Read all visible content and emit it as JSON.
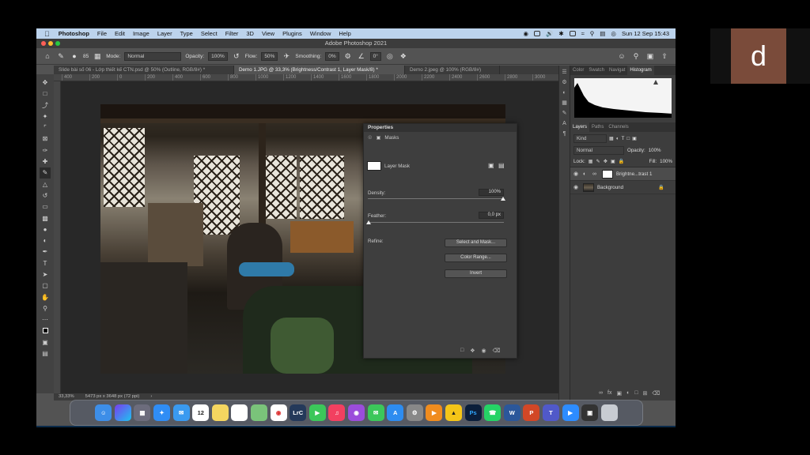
{
  "menubar": {
    "app": "Photoshop",
    "items": [
      "File",
      "Edit",
      "Image",
      "Layer",
      "Type",
      "Select",
      "Filter",
      "3D",
      "View",
      "Plugins",
      "Window",
      "Help"
    ],
    "datetime": "Sun 12 Sep  15:43"
  },
  "window": {
    "title": "Adobe Photoshop 2021"
  },
  "options": {
    "brush_size": "85",
    "mode_label": "Mode:",
    "mode_value": "Normal",
    "opacity_label": "Opacity:",
    "opacity_value": "100%",
    "flow_label": "Flow:",
    "flow_value": "50%",
    "smoothing_label": "Smoothing:",
    "smoothing_value": "0%",
    "angle_value": "0°"
  },
  "tabs": [
    "Slide bài số 06 - Lớp thiết kế CTN.psd @ 50% (Outline, RGB/8#) *",
    "Demo 1.JPG @ 33,3% (Brightness/Contrast 1, Layer Mask/8) *",
    "Demo 2.jpeg @ 100% (RGB/8#)"
  ],
  "ruler_ticks": [
    "400",
    "200",
    "0",
    "200",
    "400",
    "600",
    "800",
    "1000",
    "1200",
    "1400",
    "1600",
    "1800",
    "2000",
    "2200",
    "2400",
    "2600",
    "2800",
    "3000"
  ],
  "status": {
    "zoom": "33,33%",
    "doc_info": "5473 px x 3648 px (72 ppi)"
  },
  "properties": {
    "title": "Properties",
    "section": "Masks",
    "layer_mask_label": "Layer Mask",
    "density_label": "Density:",
    "density_value": "100%",
    "feather_label": "Feather:",
    "feather_value": "0,0 px",
    "refine_label": "Refine:",
    "select_and_mask": "Select and Mask...",
    "color_range": "Color Range...",
    "invert": "Invert"
  },
  "right_panel": {
    "top_tabs": [
      "Color",
      "Swatch",
      "Navigat",
      "Histogram"
    ],
    "layer_tabs": [
      "Layers",
      "Paths",
      "Channels"
    ],
    "kind_label": "Kind",
    "blend_mode": "Normal",
    "opacity_label": "Opacity:",
    "opacity_value": "100%",
    "lock_label": "Lock:",
    "fill_label": "Fill:",
    "fill_value": "100%",
    "layers": [
      {
        "name": "Brightne...trast 1"
      },
      {
        "name": "Background"
      }
    ]
  },
  "dock": [
    "Finder",
    "Siri",
    "Launchpad",
    "Safari",
    "Mail",
    "Calendar",
    "Notes",
    "Reminders",
    "Maps",
    "Chrome",
    "LrC",
    "Facetime",
    "Music",
    "Podcasts",
    "Messages",
    "App Store",
    "System Preferences",
    "VLC",
    "Drop",
    "Ps",
    "WhatsApp",
    "Word",
    "PowerPoint",
    "Teams",
    "Zoom",
    "Screen",
    "Trash"
  ],
  "dock_date": "12",
  "avatar_letter": "d"
}
